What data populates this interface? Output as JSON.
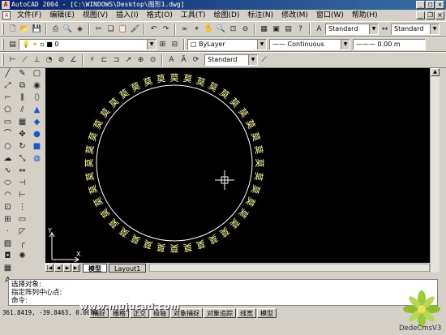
{
  "window": {
    "title": "AutoCAD 2004 - [C:\\WINDOWS\\Desktop\\图形1.dwg]",
    "app_icon": "A"
  },
  "menu": {
    "items": [
      "文件(F)",
      "编辑(E)",
      "视图(V)",
      "插入(I)",
      "格式(O)",
      "工具(T)",
      "绘图(D)",
      "标注(N)",
      "修改(M)",
      "窗口(W)",
      "帮助(H)"
    ]
  },
  "toolbar": {
    "text_style": "Standard",
    "dim_style": "Standard",
    "layer_name": "0",
    "color_control": "ByLayer",
    "linetype": "Continuous",
    "lineweight": "0.00 m",
    "dim_style_2": "Standard"
  },
  "drawing": {
    "ring_char": "莫",
    "ring_count": 40,
    "inner_radius": 96,
    "text_color": "#ffff99",
    "circle_color": "#ffffff",
    "ucs_x": "X",
    "ucs_y": "Y"
  },
  "tabs": {
    "model": "模型",
    "layout": "Layout1"
  },
  "command": {
    "lines": [
      "选择对象:",
      "指定阵列中心点:",
      "命令:"
    ]
  },
  "status": {
    "coords": "361.8419, -39.8463, 0.0000",
    "buttons": [
      "捕捉",
      "栅格",
      "正交",
      "极轴",
      "对象捕捉",
      "对象追踪",
      "线宽",
      "模型"
    ]
  },
  "watermark": "www.mujucad.com",
  "logo_text": "DedeCmsV3"
}
